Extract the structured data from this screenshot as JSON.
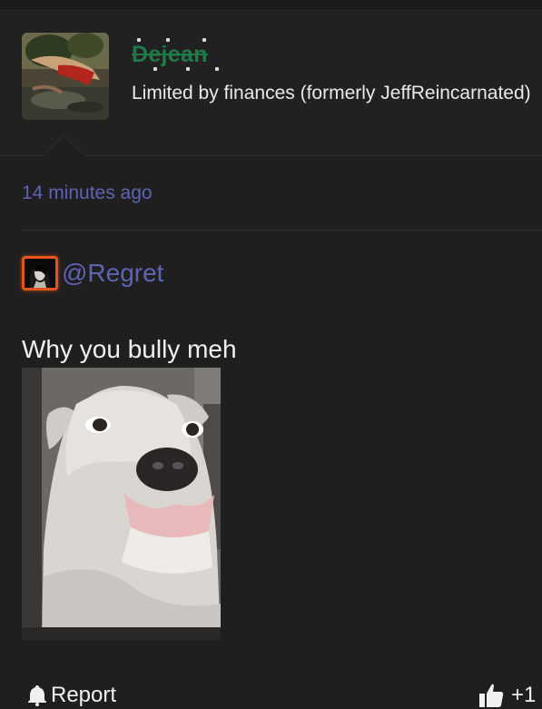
{
  "header": {
    "username": "Dejean",
    "user_title": "Limited by finances (formerly JeffReincarnated)"
  },
  "post": {
    "timestamp": "14 minutes ago",
    "mention": "@Regret",
    "text": "Why you bully meh"
  },
  "actions": {
    "report_label": "Report",
    "like_label": "+1"
  },
  "icons": {
    "report": "bell-icon",
    "like": "thumbs-up-icon"
  },
  "colors": {
    "background": "#1f1f20",
    "username": "#1f7a4a",
    "link": "#5f63b4",
    "mention_border": "#e4551c"
  }
}
